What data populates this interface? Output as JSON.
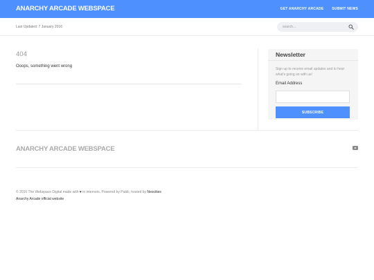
{
  "header": {
    "brand": "ANARCHY ARCADE WEBSPACE",
    "nav": [
      "GET ANARCHY ARCADE",
      "SUBMIT NEWS"
    ]
  },
  "subbar": {
    "last_updated": "Last Updated: 7 January 2016",
    "search_placeholder": "search..."
  },
  "main": {
    "code": "404",
    "message": "Ooops, something went wrong"
  },
  "newsletter": {
    "title": "Newsletter",
    "text": "Sign up to receive email updates and to hear what's going on with us!",
    "email_label": "Email Address",
    "email_value": "",
    "button": "SUBSCRIBE"
  },
  "footer": {
    "brand": "ANARCHY ARCADE WEBSPACE",
    "copyright_prefix": "© 2016 The Webspace Digital made with",
    "heart": "♥",
    "copyright_middle": "in internets. Powered by Publii, hosted by",
    "host": "Neocities",
    "official": "Anarchy Arcade official website"
  },
  "colors": {
    "accent": "#4d90fe",
    "sidebar_bg": "#f5f5f5",
    "muted": "#999999"
  },
  "icons": {
    "search": "search-icon",
    "social": "youtube-icon"
  }
}
